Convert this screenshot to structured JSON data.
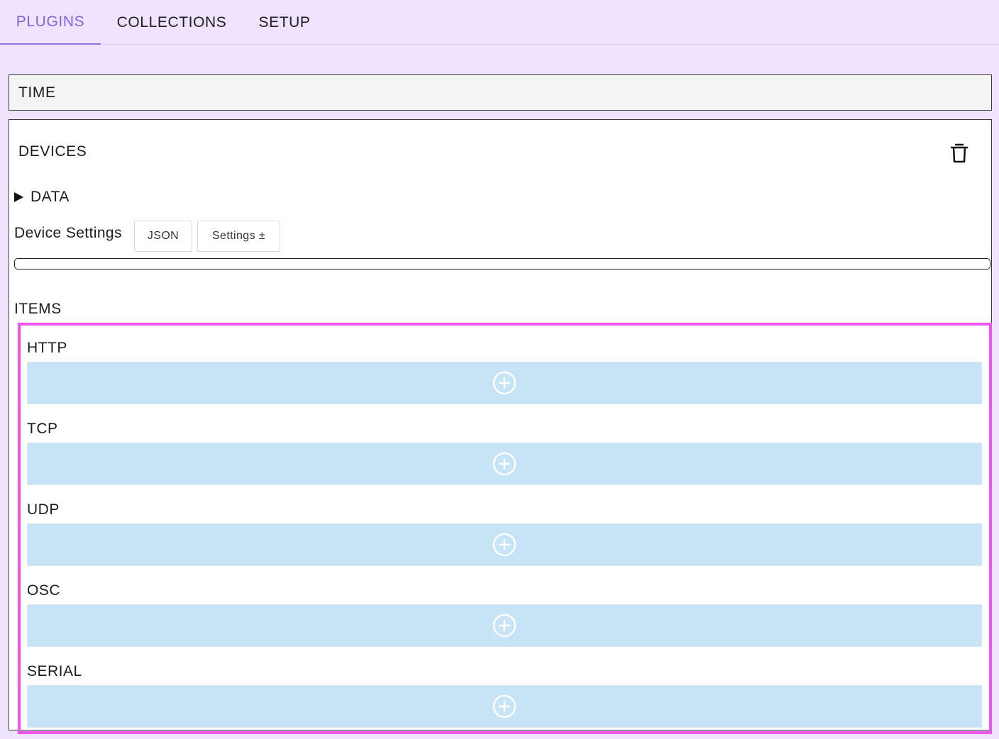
{
  "tabs": [
    {
      "label": "PLUGINS",
      "active": true
    },
    {
      "label": "COLLECTIONS",
      "active": false
    },
    {
      "label": "SETUP",
      "active": false
    }
  ],
  "time_panel": {
    "title": "TIME"
  },
  "devices": {
    "title": "DEVICES",
    "data_toggle": "DATA",
    "device_settings_label": "Device Settings",
    "json_button": "JSON",
    "settings_button": "Settings ±",
    "settings_value": "",
    "items_label": "ITEMS",
    "items": [
      {
        "label": "HTTP"
      },
      {
        "label": "TCP"
      },
      {
        "label": "UDP"
      },
      {
        "label": "OSC"
      },
      {
        "label": "SERIAL"
      }
    ]
  },
  "colors": {
    "accent": "#7b68d8",
    "background": "#efe3fd",
    "add_bar": "#c6e4f6",
    "highlight_border": "#ee55ee"
  }
}
